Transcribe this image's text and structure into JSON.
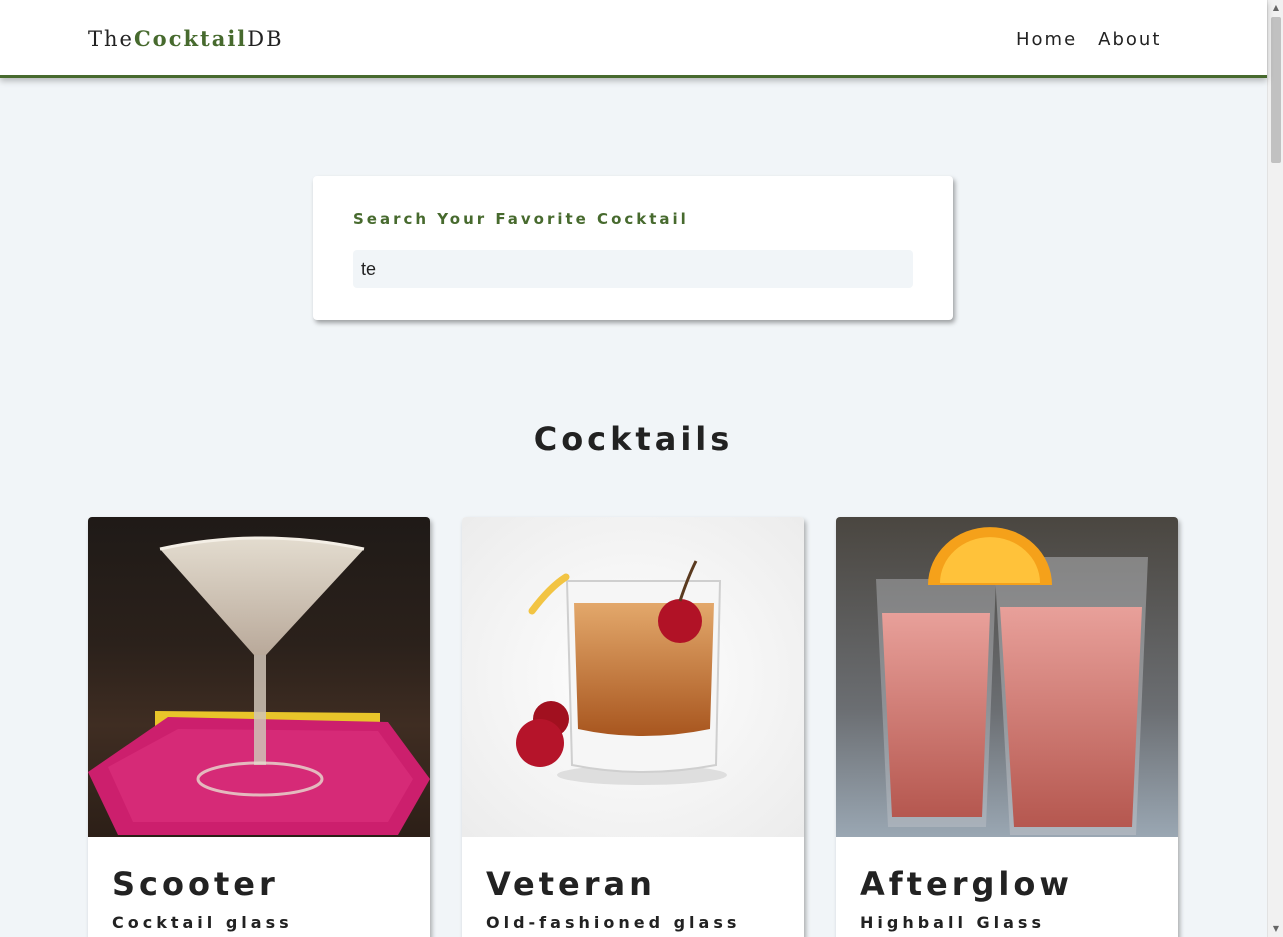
{
  "navbar": {
    "logo": {
      "prefix": "The",
      "accent": "Cocktail",
      "suffix": "DB"
    },
    "links": [
      "Home",
      "About"
    ]
  },
  "search": {
    "label": "Search Your Favorite Cocktail",
    "value": "te"
  },
  "section": {
    "title": "Cocktails"
  },
  "cocktails": [
    {
      "name": "Scooter",
      "glass": "Cocktail glass"
    },
    {
      "name": "Veteran",
      "glass": "Old-fashioned glass"
    },
    {
      "name": "Afterglow",
      "glass": "Highball Glass"
    }
  ],
  "colors": {
    "accent": "#476a2e",
    "background": "#f1f5f8"
  }
}
